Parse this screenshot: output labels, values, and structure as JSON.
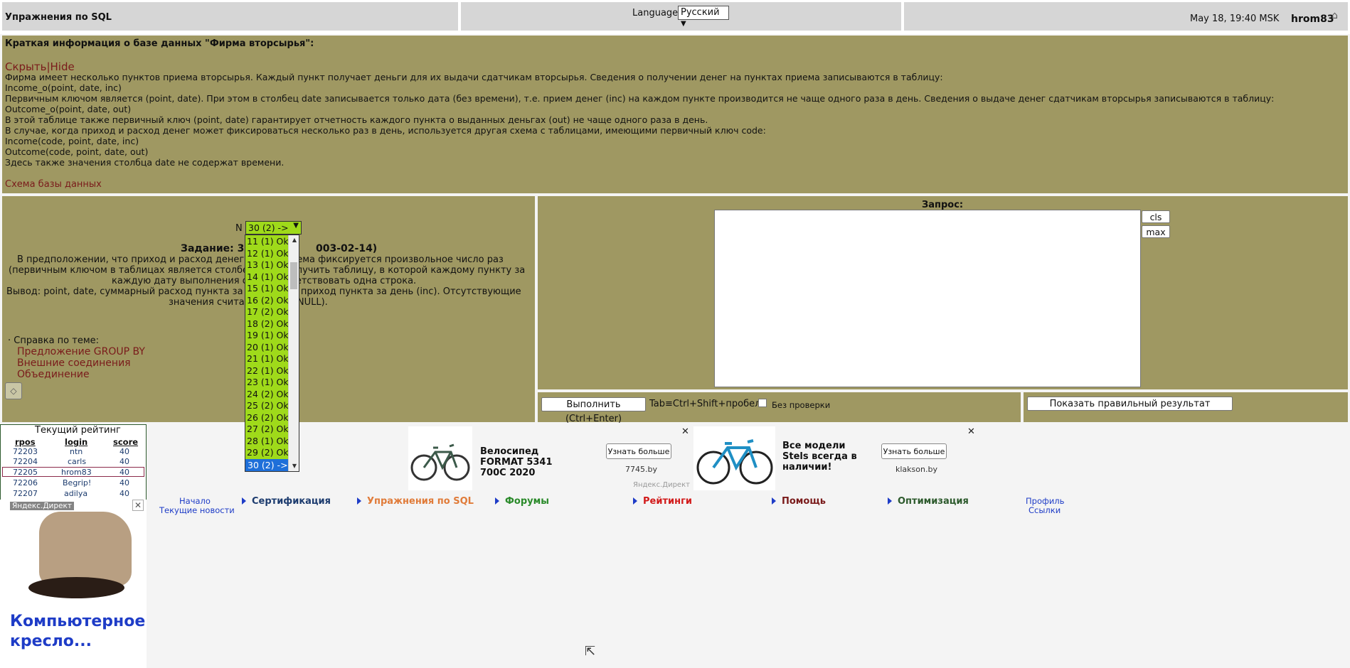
{
  "header": {
    "site_title": "Упражнения по SQL",
    "language_label": "Language",
    "language_value": "Русский",
    "datetime": "May 18, 19:40 MSK",
    "username": "hrom83"
  },
  "info": {
    "title": "Краткая информация о базе данных \"Фирма вторсырья\":",
    "hide_link": "Скрыть|Hide",
    "lines": [
      "Фирма имеет несколько пунктов приема вторсырья. Каждый пункт получает деньги для их выдачи сдатчикам вторсырья. Сведения о получении денег на пунктах приема записываются в таблицу:",
      "Income_o(point, date, inc)",
      "Первичным ключом является (point, date). При этом в столбец date записывается только дата (без времени), т.е. прием денег (inc) на каждом пункте производится не чаще одного раза в день. Сведения о выдаче денег сдатчикам вторсырья записываются в таблицу:",
      "Outcome_o(point, date, out)",
      "В этой таблице также первичный ключ (point, date) гарантирует отчетность каждого пункта о выданных деньгах (out) не чаще одного раза в день.",
      "В случае, когда приход и расход денег может фиксироваться несколько раз в день, используется другая схема с таблицами, имеющими первичный ключ code:",
      "Income(code, point, date, inc)",
      "Outcome(code, point, date, out)",
      "Здесь также значения столбца date не содержат времени."
    ],
    "schema_link": "Схема базы данных"
  },
  "task": {
    "n_label": "N",
    "selected": "30 (2) ->",
    "title_left": "Задание: 30",
    "title_right": "003-02-14)",
    "lines": [
      "В предположении, что приход и расход денег на к          е приема фиксируется произвольное число раз",
      "(первичным ключом в таблицах является столбец co          ся получить таблицу, в которой каждому пункту за",
      "каждую дату выполнения опер          соответствовать одна строка.",
      "Вывод: point, date, суммарный расход пункта за ден          арный приход пункта за день (inc). Отсутствующие",
      "значения считать          нными (NULL)."
    ],
    "help_label": "· Справка по теме:",
    "help_links": [
      "Предложение GROUP BY",
      "Внешние соединения",
      "Объединение"
    ],
    "dropdown_items": [
      "11 (1) Ok",
      "12 (1) Ok",
      "13 (1) Ok",
      "14 (1) Ok",
      "15 (1) Ok",
      "16 (2) Ok",
      "17 (2) Ok",
      "18 (2) Ok",
      "19 (1) Ok",
      "20 (1) Ok",
      "21 (1) Ok",
      "22 (1) Ok",
      "23 (1) Ok",
      "24 (2) Ok",
      "25 (2) Ok",
      "26 (2) Ok",
      "27 (2) Ok",
      "28 (1) Ok",
      "29 (2) Ok"
    ],
    "dropdown_selected": "30 (2) ->"
  },
  "query": {
    "label": "Запрос:",
    "cls_label": "cls",
    "max_label": "max",
    "exec_label": "Выполнить (Ctrl+Enter)",
    "hotkey_label": "Tab≡Ctrl+Shift+пробел",
    "nocheck_label": "Без  проверки",
    "show_result_label": "Показать правильный результат"
  },
  "rating": {
    "title": "Текущий рейтинг",
    "headers": [
      "rpos",
      "login",
      "score"
    ],
    "rows": [
      [
        "72203",
        "ntn",
        "40"
      ],
      [
        "72204",
        "carls",
        "40"
      ],
      [
        "72205",
        "hrom83",
        "40"
      ],
      [
        "72206",
        "Begrip!",
        "40"
      ],
      [
        "72207",
        "adilya",
        "40"
      ]
    ]
  },
  "ads": {
    "chair_label": "Яндекс.Директ",
    "chair_text": "Компьютерное кресло...",
    "bike1_title": "Велосипед FORMAT 5341 700C 2020",
    "bike1_button": "Узнать больше",
    "bike1_domain": "7745.by",
    "bike2_title": "Все модели Stels всегда в наличии!",
    "bike2_button": "Узнать больше",
    "bike2_domain": "klakson.by",
    "yandex_direct": "Яндекс.Директ"
  },
  "nav": {
    "start": "Начало",
    "news": "Текущие новости",
    "certification": "Сертификация",
    "exercises": "Упражнения по SQL",
    "forums": "Форумы",
    "ratings": "Рейтинги",
    "help": "Помощь",
    "optimization": "Оптимизация",
    "profile": "Профиль",
    "links": "Ссылки"
  }
}
